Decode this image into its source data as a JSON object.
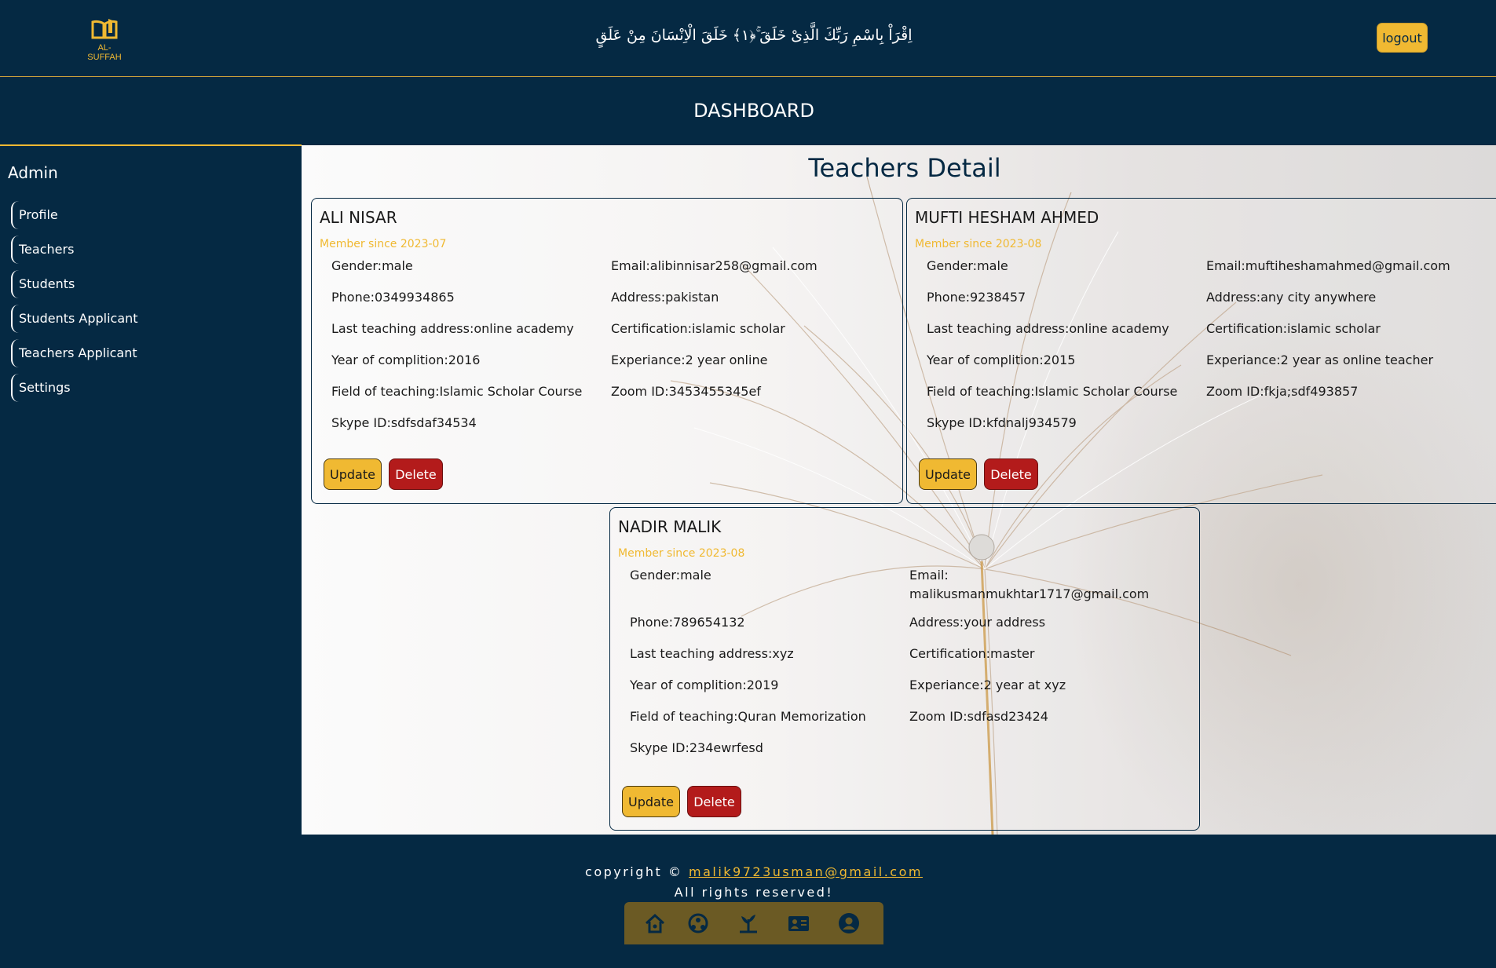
{
  "header": {
    "logo_text": "AL-SUFFAH",
    "verse": "اِقْرَاْ بِاسْمِ رَبِّكَ الَّذِیْ خَلَقَ ۚ﴿۱﴾ خَلَقَ الْاِنْسَانَ مِنْ عَلَقٍ",
    "logout_label": "logout",
    "dashboard_title": "DASHBOARD"
  },
  "sidebar": {
    "heading": "Admin",
    "items": [
      {
        "label": "Profile"
      },
      {
        "label": "Teachers"
      },
      {
        "label": "Students"
      },
      {
        "label": "Students Applicant"
      },
      {
        "label": "Teachers Applicant"
      },
      {
        "label": "Settings"
      }
    ]
  },
  "main": {
    "title": "Teachers Detail",
    "update_label": "Update",
    "delete_label": "Delete",
    "teachers": [
      {
        "name": "ALI NISAR",
        "since": "Member since 2023-07",
        "gender": "Gender:male",
        "email": "Email:alibinnisar258@gmail.com",
        "phone": "Phone:0349934865",
        "address": "Address:pakistan",
        "last_address": "Last teaching address:online academy",
        "certification": "Certification:islamic scholar",
        "year": "Year of complition:2016",
        "experience": "Experiance:2 year online",
        "field": "Field of teaching:Islamic Scholar Course",
        "zoom": "Zoom ID:3453455345ef",
        "skype": "Skype ID:sdfsdaf34534"
      },
      {
        "name": "MUFTI HESHAM AHMED",
        "since": "Member since 2023-08",
        "gender": "Gender:male",
        "email": "Email:muftiheshamahmed@gmail.com",
        "phone": "Phone:9238457",
        "address": "Address:any city anywhere",
        "last_address": "Last teaching address:online academy",
        "certification": "Certification:islamic scholar",
        "year": "Year of complition:2015",
        "experience": "Experiance:2 year as online teacher",
        "field": "Field of teaching:Islamic Scholar Course",
        "zoom": "Zoom ID:fkja;sdf493857",
        "skype": "Skype ID:kfdnalj934579"
      },
      {
        "name": "NADIR MALIK",
        "since": "Member since 2023-08",
        "gender": "Gender:male",
        "email_label": "Email:",
        "email_value": "malikusmanmukhtar1717@gmail.com",
        "phone": "Phone:789654132",
        "address": "Address:your address",
        "last_address": "Last teaching address:xyz",
        "certification": "Certification:master",
        "year": "Year of complition:2019",
        "experience": "Experiance:2 year at xyz",
        "field": "Field of teaching:Quran Memorization",
        "zoom": "Zoom ID:sdfasd23424",
        "skype": "Skype ID:234ewrfesd"
      }
    ]
  },
  "footer": {
    "copyright_prefix": "copyright ©",
    "email": "malik9723usman@gmail.com",
    "rights": "All rights reserved!",
    "nav_icons": [
      "home-icon",
      "community-icon",
      "growth-icon",
      "contact-card-icon",
      "account-icon"
    ]
  },
  "colors": {
    "navy": "#052943",
    "gold": "#f0b932",
    "delete_red": "#b31b1b",
    "nav_bar": "#6b5a24"
  }
}
